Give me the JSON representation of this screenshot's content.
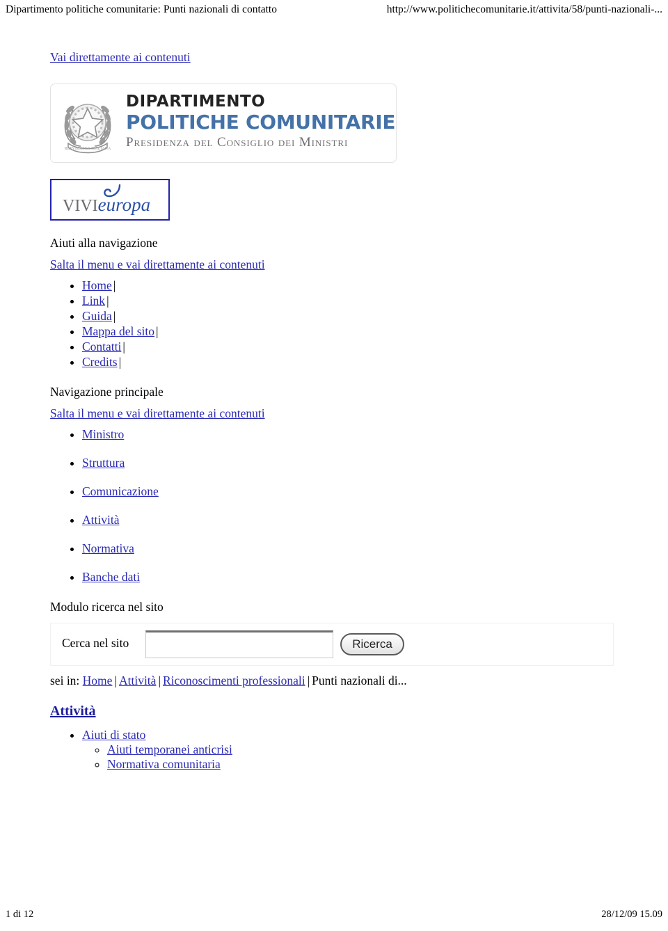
{
  "print_header": {
    "doc_title": "Dipartimento politiche comunitarie: Punti nazionali di contatto",
    "doc_url": "http://www.politichecomunitarie.it/attivita/58/punti-nazionali-..."
  },
  "print_footer": {
    "page_number": "1 di 12",
    "timestamp": "28/12/09 15.09"
  },
  "skip_link_top": "Vai direttamente ai contenuti",
  "logo": {
    "line1": "DIPARTIMENTO",
    "line2": "POLITICHE COMUNITARIE",
    "line3": "Presidenza del Consiglio dei Ministri",
    "emblem_name": "italian-republic-emblem",
    "brand_blue": "#4472a8",
    "text_dark": "#232323",
    "subtitle_gray": "#6f6f74"
  },
  "vivieuropa": {
    "part1": "VIVI",
    "part2": "europa",
    "border_color": "#2222aa",
    "blue": "#2a4fa8",
    "gray": "#6b6b6b"
  },
  "nav_help": {
    "heading": "Aiuti alla navigazione",
    "skip_link": "Salta il menu e vai direttamente ai contenuti",
    "items": [
      {
        "label": "Home",
        "separator": "|"
      },
      {
        "label": "Link",
        "separator": "|"
      },
      {
        "label": "Guida",
        "separator": "|"
      },
      {
        "label": "Mappa del sito",
        "separator": "|"
      },
      {
        "label": "Contatti",
        "separator": "|"
      },
      {
        "label": "Credits",
        "separator": "|"
      }
    ]
  },
  "nav_main": {
    "heading": "Navigazione principale",
    "skip_link": "Salta il menu e vai direttamente ai contenuti",
    "items": [
      {
        "label": "Ministro"
      },
      {
        "label": "Struttura"
      },
      {
        "label": "Comunicazione"
      },
      {
        "label": "Attività"
      },
      {
        "label": "Normativa"
      },
      {
        "label": "Banche dati"
      }
    ]
  },
  "search": {
    "heading": "Modulo ricerca nel sito",
    "label": "Cerca nel sito",
    "value": "",
    "placeholder": "",
    "button_label": "Ricerca"
  },
  "breadcrumb": {
    "prefix": "sei in:",
    "separator": "|",
    "items": [
      {
        "label": "Home",
        "link": true
      },
      {
        "label": "Attività",
        "link": true
      },
      {
        "label": "Riconoscimenti professionali",
        "link": true
      },
      {
        "label": "Punti nazionali di...",
        "link": false
      }
    ]
  },
  "content": {
    "heading": "Attività",
    "tree": [
      {
        "label": "Aiuti di stato",
        "children": [
          {
            "label": "Aiuti temporanei anticrisi"
          },
          {
            "label": "Normativa comunitaria"
          }
        ]
      }
    ]
  },
  "colors": {
    "link": "#2b2bb5",
    "heading_link": "#1d1d9e",
    "page_bg": "#ffffff"
  }
}
